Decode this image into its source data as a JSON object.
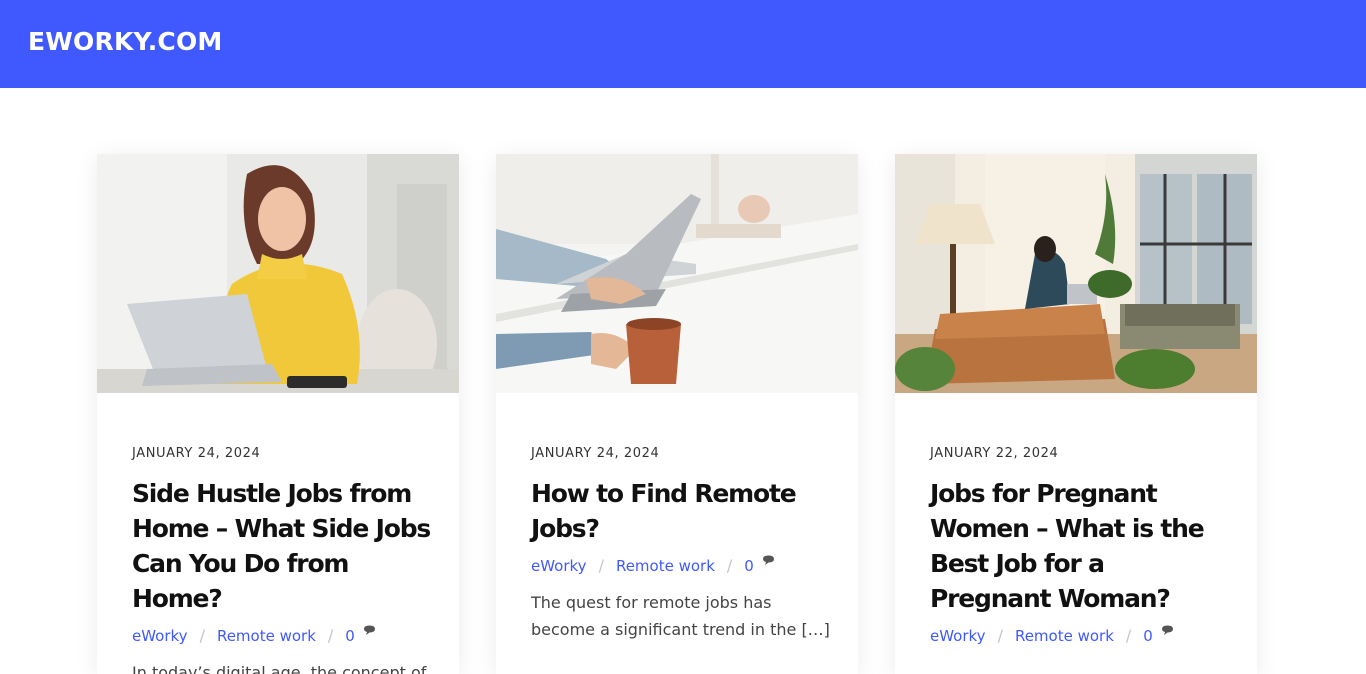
{
  "site": {
    "title": "EWORKY.COM"
  },
  "posts": [
    {
      "date": "JANUARY 24, 2024",
      "title": "Side Hustle Jobs from Home – What Side Jobs Can You Do from Home?",
      "author": "eWorky",
      "category": "Remote work",
      "comments": "0",
      "excerpt": "In today’s digital age, the concept of"
    },
    {
      "date": "JANUARY 24, 2024",
      "title": "How to Find Remote Jobs?",
      "author": "eWorky",
      "category": "Remote work",
      "comments": "0",
      "excerpt": "The quest for remote jobs has become a significant trend in the […]"
    },
    {
      "date": "JANUARY 22, 2024",
      "title": "Jobs for Pregnant Women – What is the Best Job for a Pregnant Woman?",
      "author": "eWorky",
      "category": "Remote work",
      "comments": "0",
      "excerpt": ""
    }
  ],
  "colors": {
    "header": "#4059ff",
    "link": "#4059ff"
  }
}
